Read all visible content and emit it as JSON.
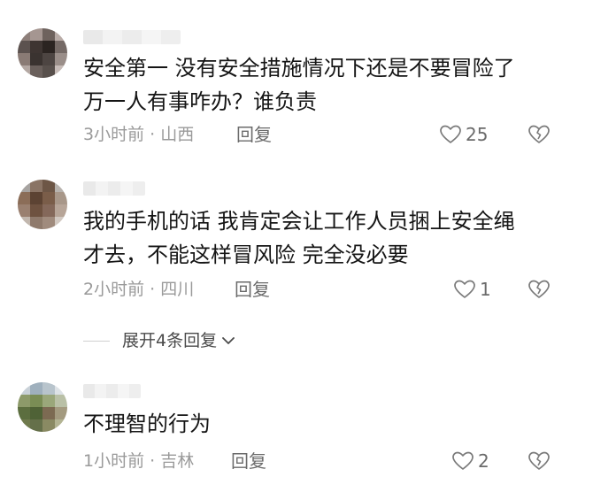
{
  "comments": [
    {
      "text": "安全第一 没有安全措施情况下还是不要冒险了\n万一人有事咋办？谁负责",
      "time": "3小时前",
      "location": "山西",
      "reply_label": "回复",
      "likes": "25"
    },
    {
      "text": "我的手机的话 我肯定会让工作人员捆上安全绳\n才去，不能这样冒风险 完全没必要",
      "time": "2小时前",
      "location": "四川",
      "reply_label": "回复",
      "likes": "1"
    },
    {
      "text": "不理智的行为",
      "time": "1小时前",
      "location": "吉林",
      "reply_label": "回复",
      "likes": "2"
    }
  ],
  "expand_replies": {
    "label": "展开4条回复"
  },
  "meta_separator": "·",
  "colors": {
    "text": "#151515",
    "meta": "#9a9a9a",
    "action": "#6b6b6b"
  }
}
